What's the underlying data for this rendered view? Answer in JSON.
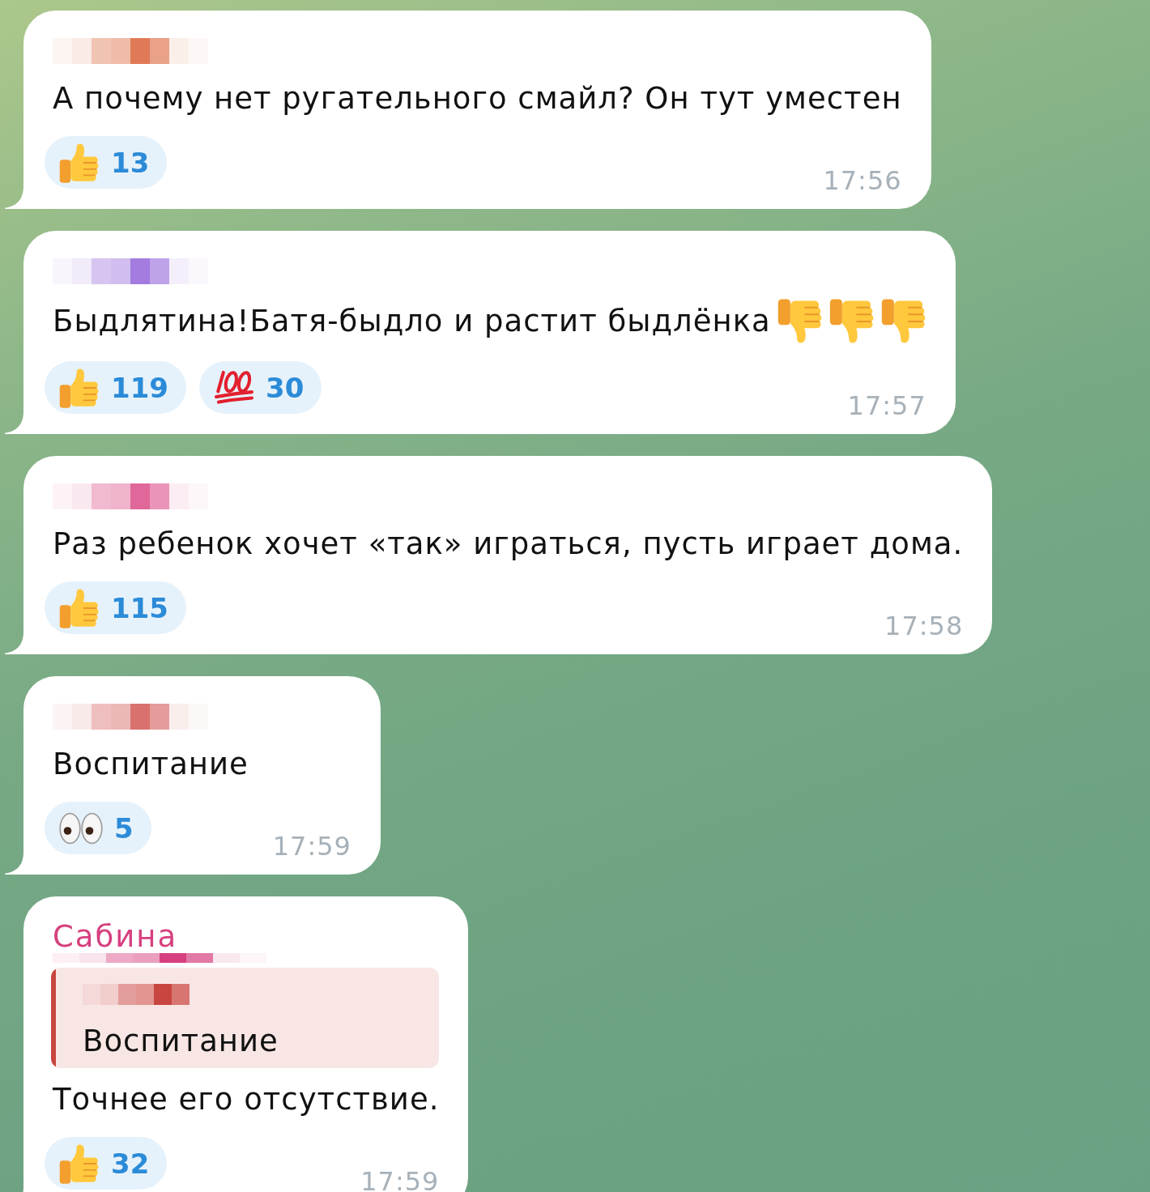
{
  "chat": {
    "messages": [
      {
        "sender": {
          "color": "#e07a56"
        },
        "text": "А почему нет ругательного смайл? Он тут уместен",
        "reactions": [
          {
            "kind": "thumbs_up",
            "count": "13",
            "selected": false
          }
        ],
        "time": "17:56"
      },
      {
        "sender": {
          "color": "#a47ce0"
        },
        "text": "Быдлятина!Батя-быдло и растит быдлёнка",
        "trailing_icons": [
          {
            "kind": "thumbs_down"
          },
          {
            "kind": "thumbs_down"
          },
          {
            "kind": "thumbs_down"
          }
        ],
        "reactions": [
          {
            "kind": "thumbs_up",
            "count": "119",
            "selected": false
          },
          {
            "kind": "hundred_points",
            "count": "30",
            "selected": false
          }
        ],
        "time": "17:57"
      },
      {
        "sender": {
          "color": "#e0679a"
        },
        "text": "Раз ребенок хочет «так» играться, пусть играет дома.",
        "reactions": [
          {
            "kind": "thumbs_up",
            "count": "115",
            "selected": false
          }
        ],
        "time": "17:58"
      },
      {
        "sender": {
          "color": "#d9716f"
        },
        "text": "Воспитание",
        "reactions": [
          {
            "kind": "eyes",
            "count": "5",
            "selected": false
          }
        ],
        "time": "17:59"
      },
      {
        "sender": {
          "name": "Сабина",
          "color": "#d6407f"
        },
        "reply": {
          "color": "#c9453f",
          "text": "Воспитание"
        },
        "text": "Точнее его отсутствие.",
        "reactions": [
          {
            "kind": "thumbs_up",
            "count": "32",
            "selected": false
          }
        ],
        "time": "17:59"
      }
    ]
  }
}
